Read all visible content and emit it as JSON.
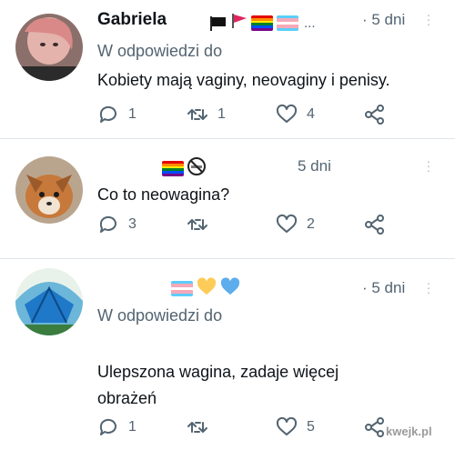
{
  "tweets": [
    {
      "name": "Gabriela",
      "time": "· 5 dni",
      "emoji_ellipsis": "...",
      "reply_to": "W odpowiedzi do",
      "text": "Kobiety mają vaginy, neovaginy i penisy.",
      "reply_count": "1",
      "retweet_count": "1",
      "like_count": "4",
      "emoji_icons": [
        "black-flag-icon",
        "red-flag-icon",
        "rainbow-flag-icon",
        "transgender-flag-icon"
      ]
    },
    {
      "name": "",
      "time": "5 dni",
      "text": "Co to neowagina?",
      "reply_count": "3",
      "retweet_count": "",
      "like_count": "2",
      "emoji_icons": [
        "rainbow-flag-icon",
        "no-smoking-icon"
      ]
    },
    {
      "name": "",
      "time": "· 5 dni",
      "reply_to": "W odpowiedzi do",
      "text_line1": "Ulepszona wagina, zadaje więcej",
      "text_line2": "obrażeń",
      "reply_count": "1",
      "retweet_count": "",
      "like_count": "5",
      "emoji_icons": [
        "transgender-flag-icon",
        "yellow-heart-icon",
        "blue-heart-icon"
      ]
    }
  ],
  "watermark": "kwejk.pl",
  "colors": {
    "text": "#0f1419",
    "secondary": "#536471",
    "divider": "#e1e6ea"
  }
}
